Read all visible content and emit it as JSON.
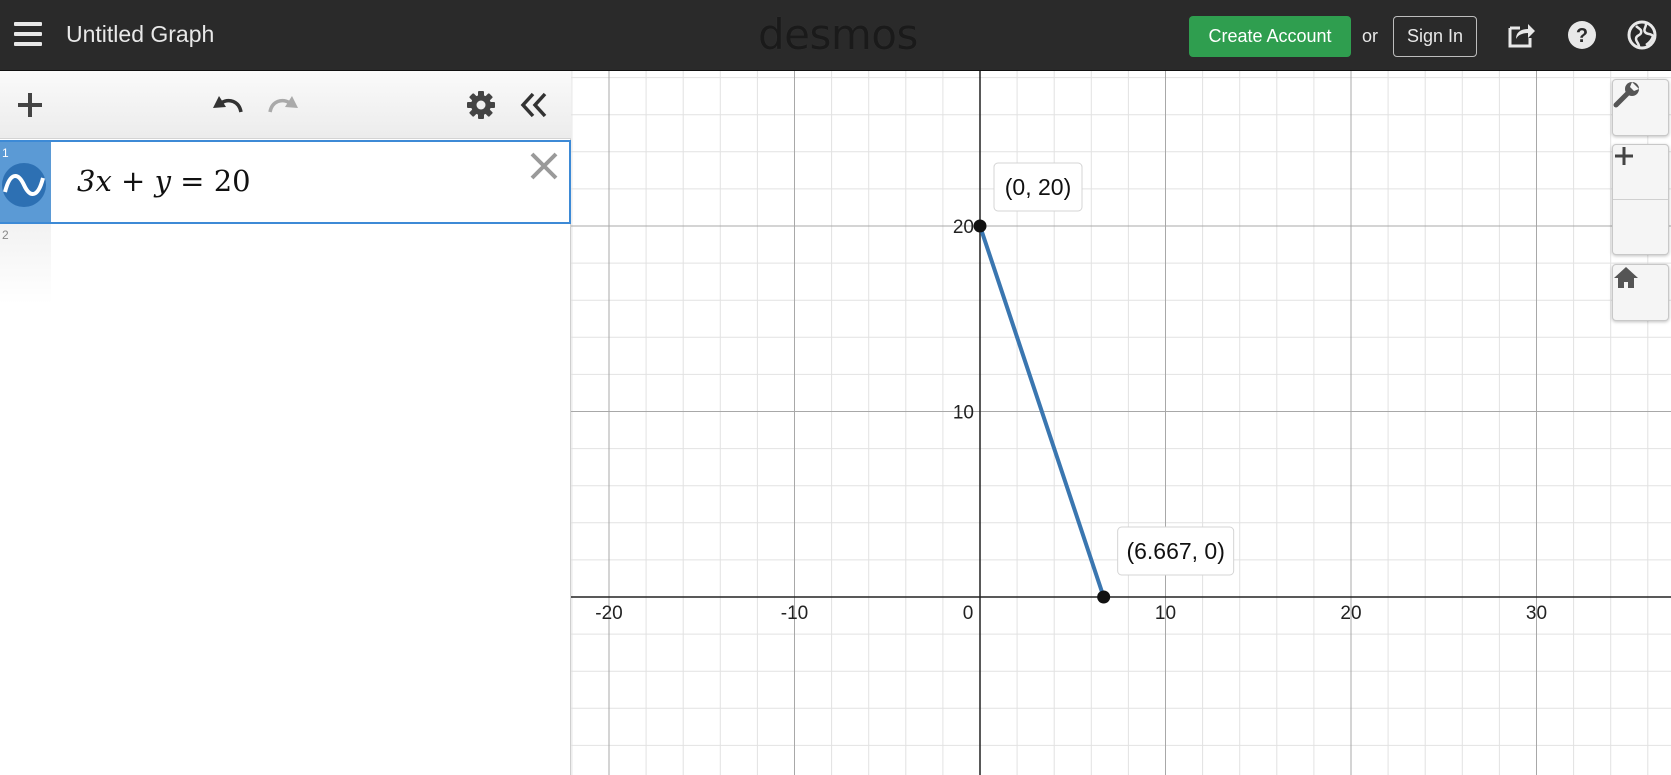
{
  "header": {
    "title": "Untitled Graph",
    "logo": "desmos",
    "create_account": "Create Account",
    "or": "or",
    "sign_in": "Sign In",
    "icons": [
      "menu-icon",
      "share-icon",
      "help-icon",
      "globe-icon"
    ]
  },
  "toolbar": {
    "icons": [
      "add-icon",
      "undo-icon",
      "redo-icon",
      "settings-icon",
      "collapse-icon"
    ]
  },
  "expressions": [
    {
      "number": "1",
      "latex": "3x + y = 20",
      "color": "#2d70b3"
    },
    {
      "number": "2",
      "latex": ""
    }
  ],
  "graph": {
    "controls": [
      "wrench-icon",
      "zoom-in-icon",
      "zoom-out-icon",
      "home-icon"
    ],
    "x_tick_labels": [
      "-20",
      "-10",
      "0",
      "10",
      "20",
      "30"
    ],
    "y_tick_labels": [
      "20",
      "10"
    ],
    "points": [
      {
        "x": 0,
        "y": 20,
        "label": "(0, 20)"
      },
      {
        "x": 6.667,
        "y": 0,
        "label": "(6.667, 0)"
      }
    ],
    "line_color": "#3a76b0"
  }
}
